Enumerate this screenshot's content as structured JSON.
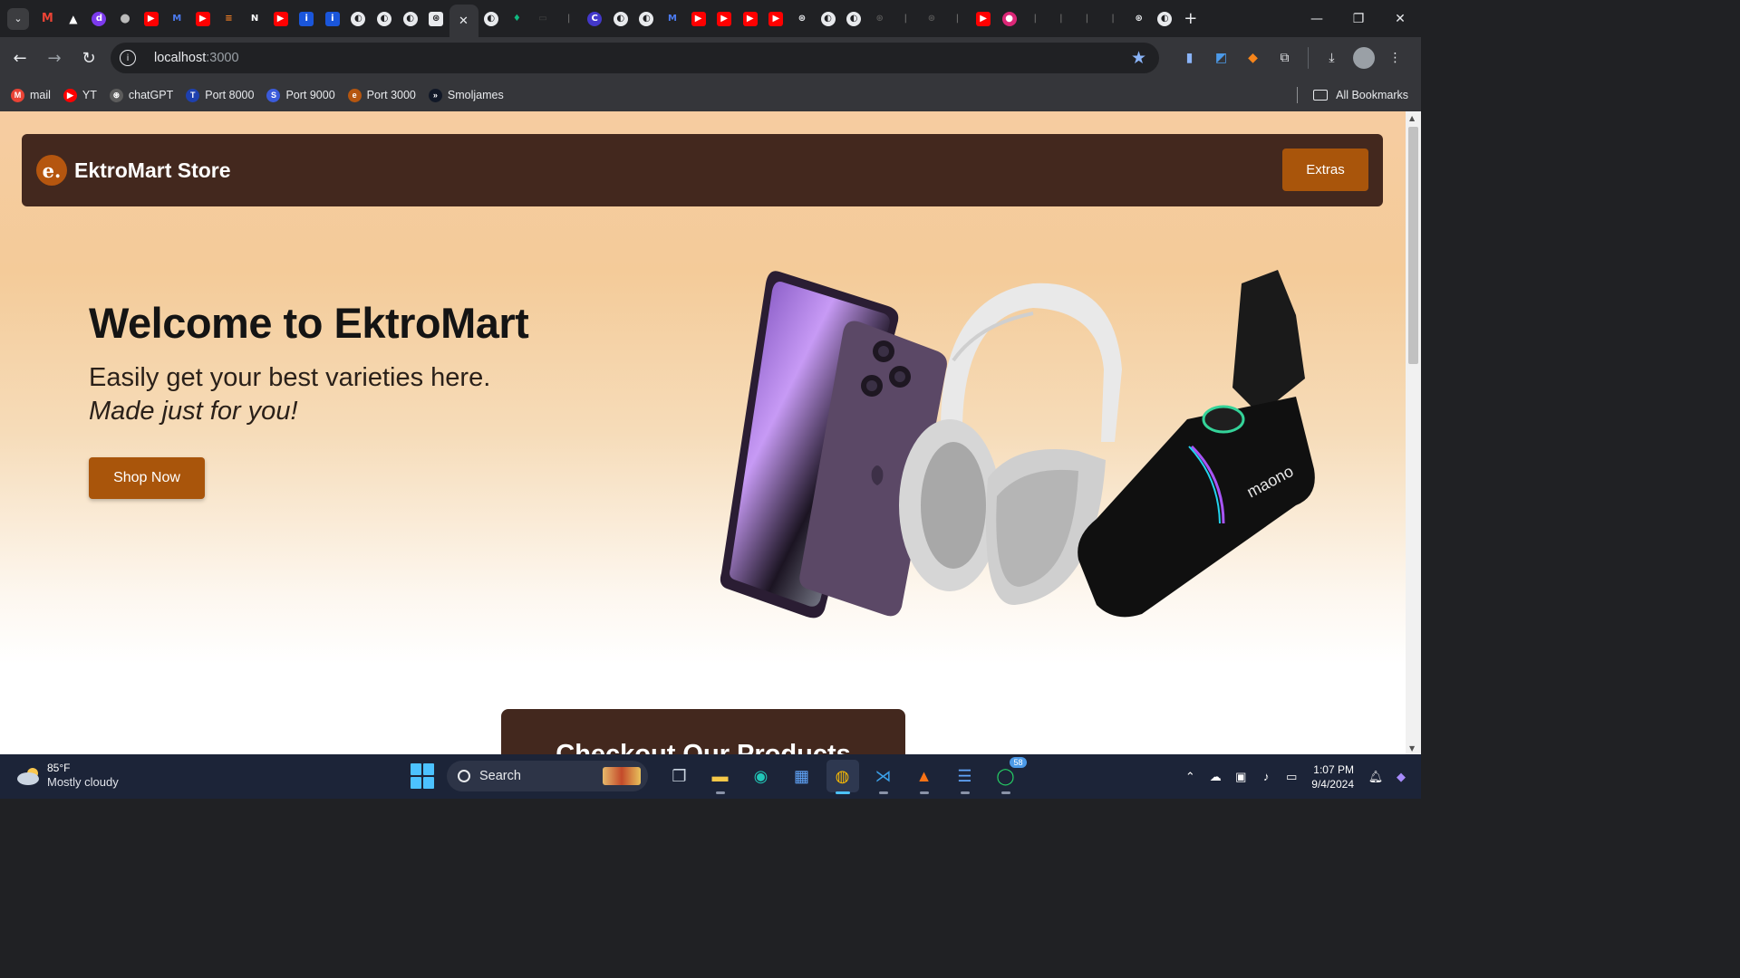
{
  "browser": {
    "address_host": "localhost",
    "address_port": ":3000",
    "bookmarks": [
      {
        "label": "mail",
        "color": "#ea4335",
        "glyph": "M"
      },
      {
        "label": "YT",
        "color": "#ff0000",
        "glyph": "▶"
      },
      {
        "label": "chatGPT",
        "color": "#5c5c5c",
        "glyph": "⊛"
      },
      {
        "label": "Port 8000",
        "color": "#1e40af",
        "glyph": "T"
      },
      {
        "label": "Port 9000",
        "color": "#3b5bdb",
        "glyph": "S"
      },
      {
        "label": "Port 3000",
        "color": "#b5560f",
        "glyph": "e"
      },
      {
        "label": "Smoljames",
        "color": "#111827",
        "glyph": "»"
      }
    ],
    "all_bookmarks_label": "All Bookmarks"
  },
  "page": {
    "brand": "EktroMart Store",
    "logo_letter": "e.",
    "extras_label": "Extras",
    "hero_title": "Welcome to EktroMart",
    "hero_subtitle": "Easily get your best varieties here.",
    "hero_tagline": "Made just for you!",
    "shop_button": "Shop Now",
    "section_heading": "Checkout Our Products",
    "hero_image_brand": "maono"
  },
  "taskbar": {
    "weather_temp": "85°F",
    "weather_desc": "Mostly cloudy",
    "search_label": "Search",
    "time": "1:07 PM",
    "date": "9/4/2024",
    "whatsapp_badge": "58"
  },
  "colors": {
    "navbar": "#43281e",
    "accent": "#a9550b",
    "hero_bg": "#f4cb99"
  }
}
